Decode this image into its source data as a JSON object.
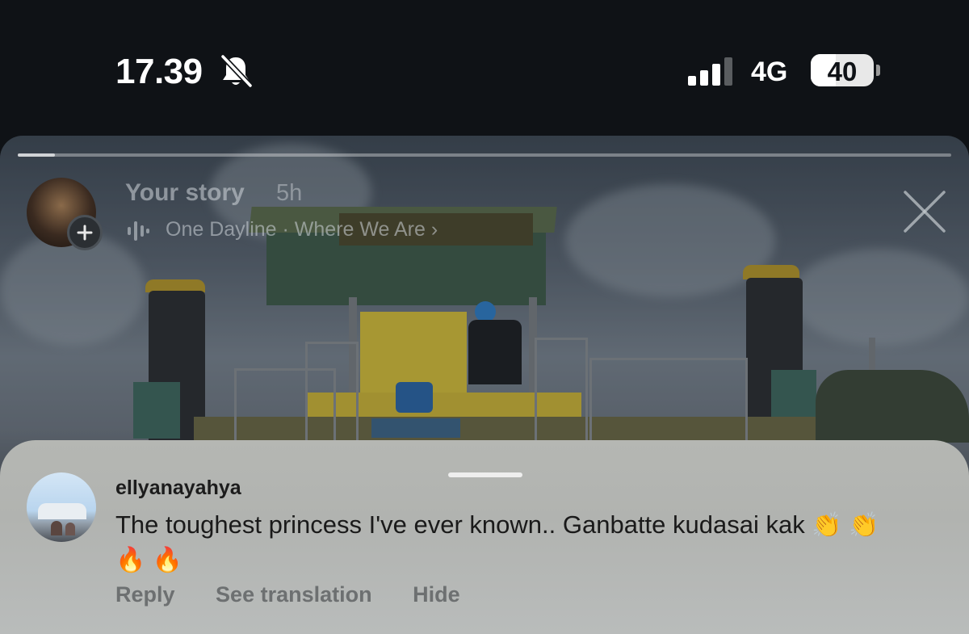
{
  "status_bar": {
    "time": "17.39",
    "network": "4G",
    "battery": "40",
    "battery_level": 0.4,
    "icons": [
      "bell-slash-icon",
      "signal-icon",
      "battery-icon"
    ]
  },
  "story_header": {
    "title": "Your story",
    "time_ago": "5h",
    "music": "One Dayline · Where We Are",
    "music_chevron": "›",
    "progress": 0.04,
    "icons": [
      "music-bars-icon",
      "plus-icon",
      "close-icon"
    ]
  },
  "comment": {
    "username": "ellyanayahya",
    "text": "The toughest princess I've ever known.. Ganbatte kudasai kak",
    "emojis": "👏 👏 🔥 🔥",
    "actions": {
      "reply": "Reply",
      "see_translation": "See translation",
      "hide": "Hide"
    }
  },
  "colors": {
    "background": "#0f1216",
    "sheet": "#b5b7b3",
    "action_text": "#6d7071",
    "machine_yellow": "#d8c23a"
  }
}
